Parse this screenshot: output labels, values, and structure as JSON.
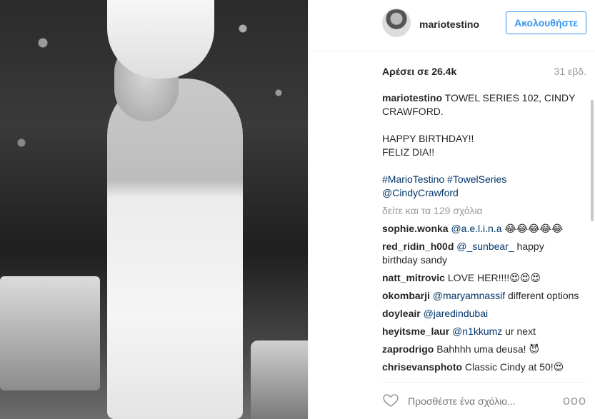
{
  "post": {
    "username": "mariotestino",
    "follow_label": "Ακολουθήστε",
    "likes": "Αρέσει σε 26.4k",
    "time": "31 εβδ.",
    "caption": {
      "user": "mariotestino",
      "line1": "TOWEL SERIES 102, CINDY CRAWFORD.",
      "line2": "HAPPY BIRTHDAY!!",
      "line3": "FELIZ DIA!!",
      "tags": "#MarioTestino #TowelSeries",
      "mention": "@CindyCrawford"
    },
    "view_all": "δείτε και τα 129 σχόλια",
    "comments": [
      {
        "user": "sophie.wonka",
        "mention": "@a.e.l.i.n.a",
        "text": " 😂😂😂😂😂"
      },
      {
        "user": "red_ridin_h00d",
        "mention": "@_sunbear_",
        "text": " happy birthday sandy"
      },
      {
        "user": "natt_mitrovic",
        "mention": "",
        "text": "LOVE HER!!!!😍😍😍"
      },
      {
        "user": "okombarji",
        "mention": "@maryamnassif",
        "text": " different options"
      },
      {
        "user": "doyleair",
        "mention": "@jaredindubai",
        "text": ""
      },
      {
        "user": "heyitsme_laur",
        "mention": "@n1kkumz",
        "text": " ur next"
      },
      {
        "user": "zaprodrigo",
        "mention": "",
        "text": "Bahhhh uma deusa! 😈"
      },
      {
        "user": "chrisevansphoto",
        "mention": "",
        "text": "Classic Cindy at 50!😍"
      }
    ],
    "add_comment_placeholder": "Προσθέστε ένα σχόλιο...",
    "more_label": "ooo"
  }
}
